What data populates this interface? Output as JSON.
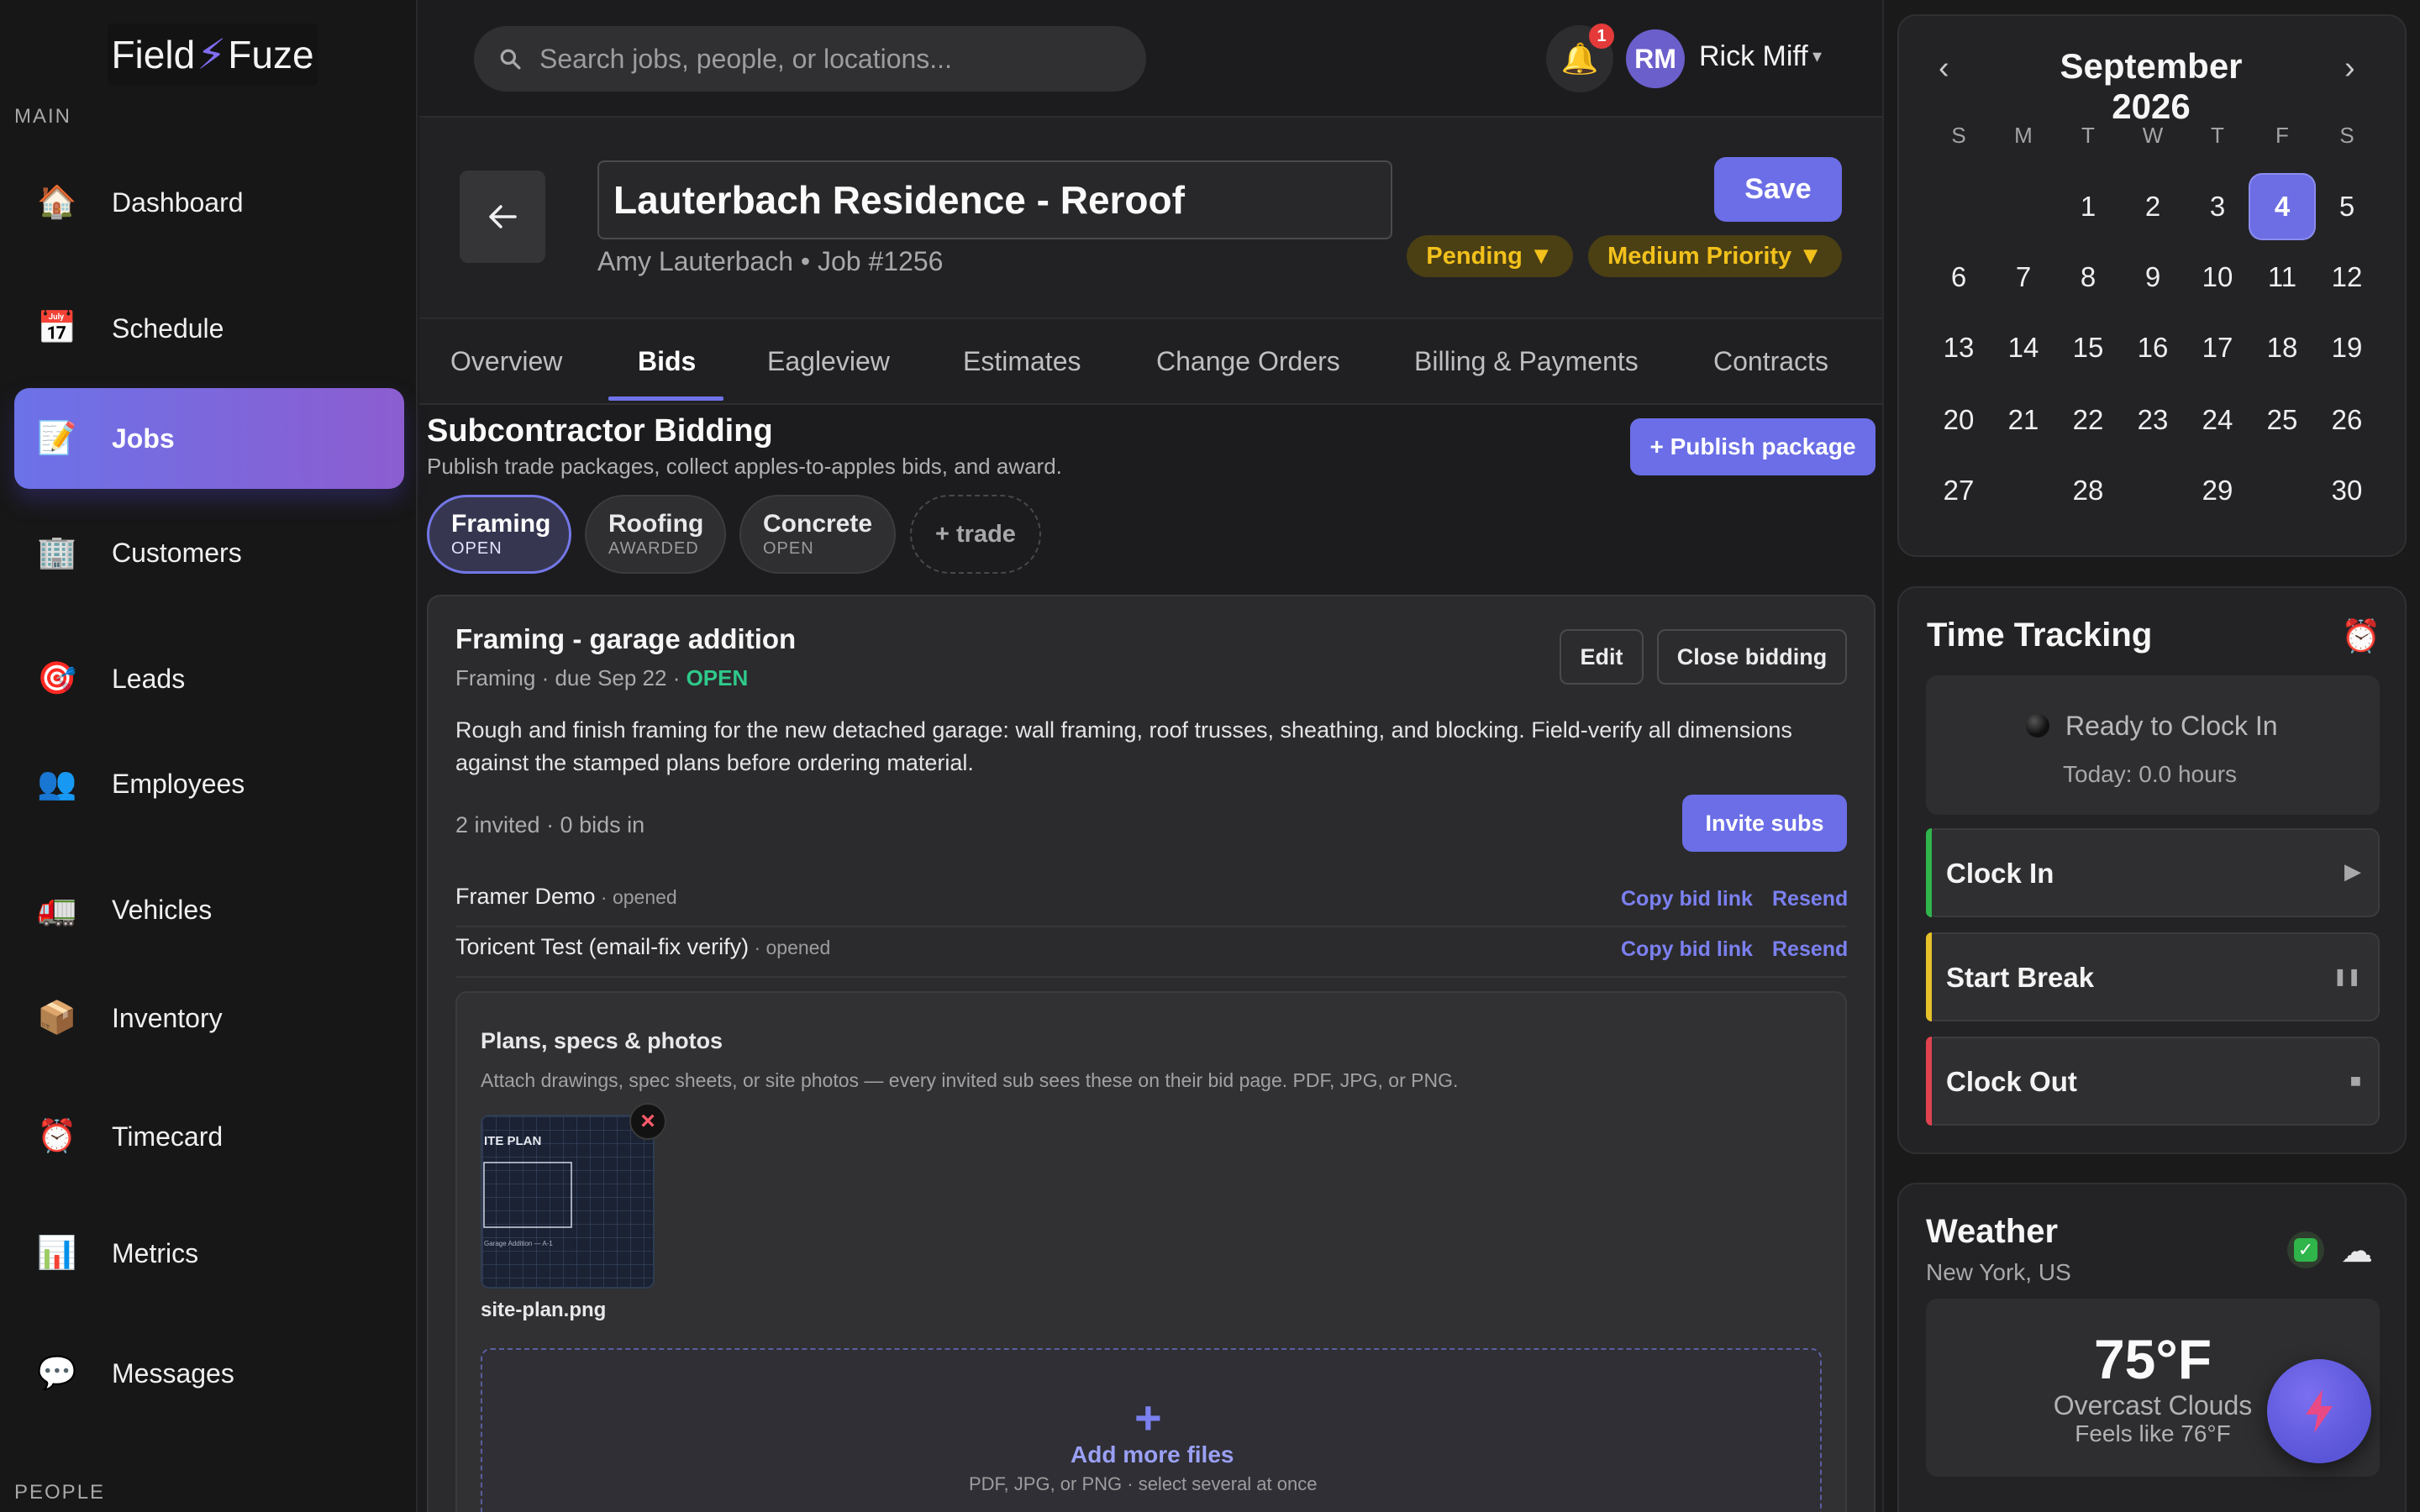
{
  "app": {
    "logo_left": "Field",
    "logo_bolt": "⚡",
    "logo_right": "Fuze"
  },
  "sidebar": {
    "section_main": "MAIN",
    "section_people": "PEOPLE",
    "items": [
      {
        "label": "Dashboard",
        "icon": "house-icon",
        "glyph": "🏠"
      },
      {
        "label": "Schedule",
        "icon": "calendar-icon",
        "glyph": "📅"
      },
      {
        "label": "Jobs",
        "icon": "memo-icon",
        "glyph": "📝",
        "active": true
      },
      {
        "label": "Customers",
        "icon": "building-icon",
        "glyph": "🏢"
      },
      {
        "label": "Leads",
        "icon": "target-icon",
        "glyph": "🎯"
      },
      {
        "label": "Employees",
        "icon": "people-icon",
        "glyph": "👥"
      },
      {
        "label": "Vehicles",
        "icon": "truck-icon",
        "glyph": "🚛"
      },
      {
        "label": "Inventory",
        "icon": "package-icon",
        "glyph": "📦"
      },
      {
        "label": "Timecard",
        "icon": "alarm-clock-icon",
        "glyph": "⏰"
      },
      {
        "label": "Metrics",
        "icon": "bar-chart-icon",
        "glyph": "📊"
      },
      {
        "label": "Messages",
        "icon": "speech-bubble-icon",
        "glyph": "💬"
      }
    ]
  },
  "topbar": {
    "search_placeholder": "Search jobs, people, or locations...",
    "notification_count": "1",
    "user_initials": "RM",
    "user_name": "Rick Miff",
    "user_caret": "▾"
  },
  "job": {
    "title": "Lauterbach Residence - Reroof",
    "subtitle": "Amy Lauterbach • Job #1256",
    "save_label": "Save",
    "status": "Pending ▼",
    "priority": "Medium Priority ▼"
  },
  "tabs": [
    "Overview",
    "Bids",
    "Eagleview",
    "Estimates",
    "Change Orders",
    "Billing & Payments",
    "Contracts"
  ],
  "active_tab": "Bids",
  "bidding": {
    "title": "Subcontractor Bidding",
    "subtitle": "Publish trade packages, collect apples-to-apples bids, and award.",
    "publish_label": "+ Publish package",
    "trades": [
      {
        "name": "Framing",
        "status": "OPEN",
        "active": true
      },
      {
        "name": "Roofing",
        "status": "AWARDED"
      },
      {
        "name": "Concrete",
        "status": "OPEN"
      }
    ],
    "add_trade_label": "+ trade",
    "package": {
      "title": "Framing - garage addition",
      "meta": "Framing · due Sep 22 · ",
      "status": "OPEN",
      "edit_label": "Edit",
      "close_label": "Close bidding",
      "description": "Rough and finish framing for the new detached garage: wall framing, roof trusses, sheathing, and blocking. Field-verify all dimensions against the stamped plans before ordering material.",
      "counts": "2 invited · 0 bids in",
      "invite_label": "Invite subs",
      "subs": [
        {
          "name": "Framer Demo",
          "state": " · opened",
          "copy": "Copy bid link",
          "resend": "Resend"
        },
        {
          "name": "Toricent Test (email-fix verify)",
          "state": " · opened",
          "copy": "Copy bid link",
          "resend": "Resend"
        }
      ],
      "files": {
        "title": "Plans, specs & photos",
        "subtitle": "Attach drawings, spec sheets, or site photos — every invited sub sees these on their bid page. PDF, JPG, or PNG.",
        "thumb_label": "ITE PLAN",
        "thumb_caption": "Garage Addition — A-1",
        "file_name": "site-plan.png",
        "add_title": "Add more files",
        "add_sub": "PDF, JPG, or PNG · select several at once"
      }
    }
  },
  "calendar": {
    "prev": "‹",
    "next": "›",
    "title": "September 2026",
    "dow": [
      "S",
      "M",
      "T",
      "W",
      "T",
      "F",
      "S"
    ],
    "today": 4,
    "weeks": [
      [
        "",
        "",
        "1",
        "2",
        "3",
        "4",
        "5"
      ],
      [
        "6",
        "7",
        "8",
        "9",
        "10",
        "11",
        "12"
      ],
      [
        "13",
        "14",
        "15",
        "16",
        "17",
        "18",
        "19"
      ],
      [
        "20",
        "21",
        "22",
        "23",
        "24",
        "25",
        "26"
      ],
      [
        "27",
        "28",
        "29",
        "30"
      ]
    ]
  },
  "time_tracking": {
    "title": "Time Tracking",
    "icon": "⏰",
    "status": "Ready to Clock In",
    "today": "Today: 0.0 hours",
    "buttons": [
      {
        "label": "Clock In",
        "glyph": "▶",
        "color": "#2fb54a"
      },
      {
        "label": "Start Break",
        "glyph": "❚❚",
        "color": "#e6c12a"
      },
      {
        "label": "Clock Out",
        "glyph": "■",
        "color": "#e0434f"
      }
    ]
  },
  "weather": {
    "title": "Weather",
    "location": "New York, US",
    "check": "✓",
    "cloud": "☁",
    "temp": "75°F",
    "desc": "Overcast Clouds",
    "feels": "Feels like 76°F"
  }
}
